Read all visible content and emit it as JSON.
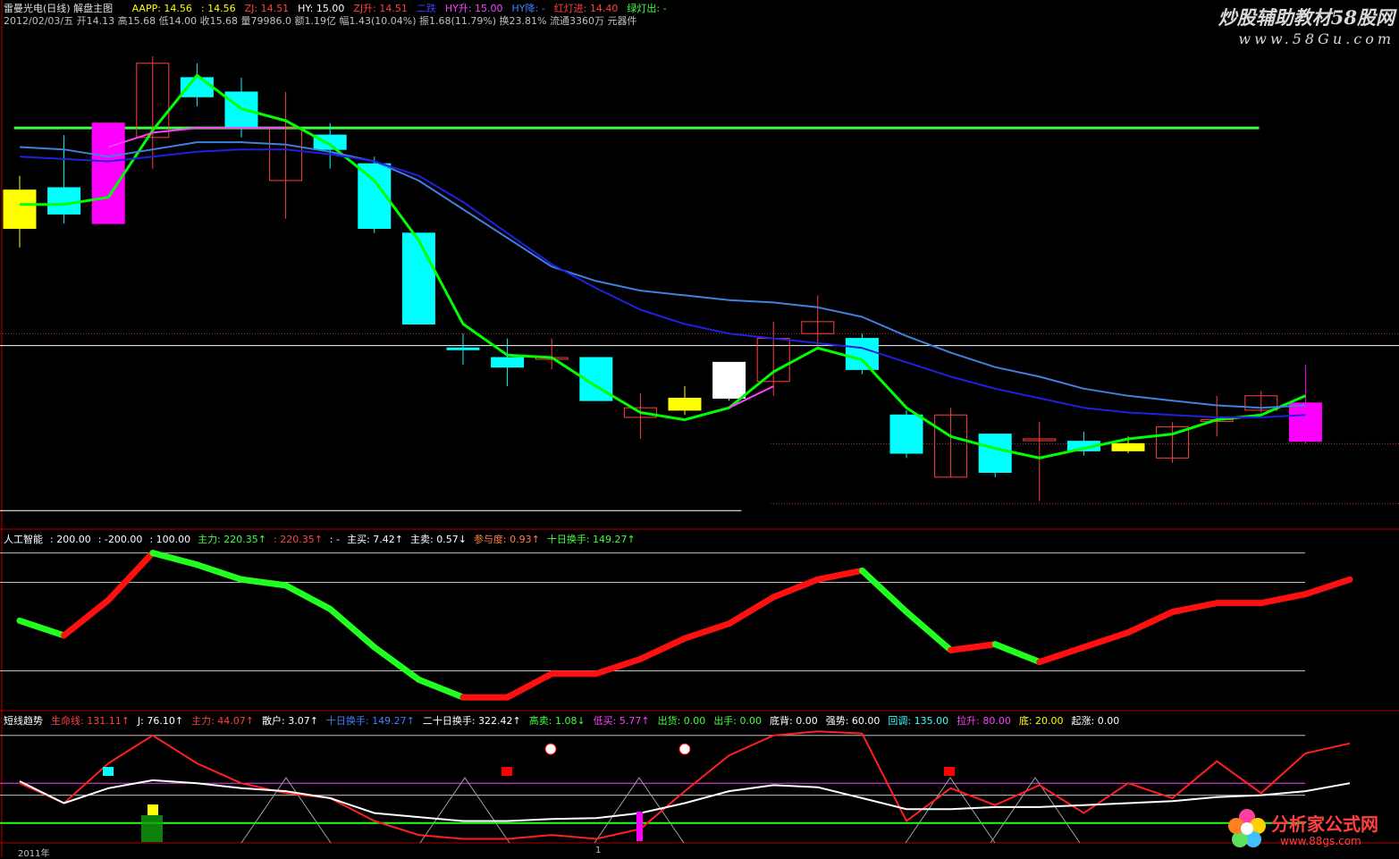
{
  "header": {
    "title": "雷曼光电(日线) 解盘主图",
    "info_line": "2012/02/03/五 开14.13 高15.68 低14.00 收15.68 量79986.0 额1.19亿 幅1.43(10.04%) 振1.68(11.79%) 换23.81% 流通3360万 元器件",
    "indicators": [
      {
        "text": "AAPP: 14.56",
        "color": "#ffff00"
      },
      {
        "text": ": 14.56",
        "color": "#ffff00"
      },
      {
        "text": "ZJ: 14.51",
        "color": "#ff4040"
      },
      {
        "text": "HY: 15.00",
        "color": "#ffffff"
      },
      {
        "text": "ZJ升: 14.51",
        "color": "#ff4040"
      },
      {
        "text": "二跌",
        "color": "#4040ff"
      },
      {
        "text": "HY升: 15.00",
        "color": "#ff40ff"
      },
      {
        "text": "HY降: -",
        "color": "#4080ff"
      },
      {
        "text": "红灯进: 14.40",
        "color": "#ff4040"
      },
      {
        "text": "绿灯出: -",
        "color": "#40ff40"
      }
    ]
  },
  "watermarks": {
    "top": "炒股辅助教材58股网",
    "top_url": "www.58Gu.com",
    "bottom": "分析家公式网",
    "bottom_url": "www.88gs.com"
  },
  "panel2_header": [
    {
      "text": "人工智能",
      "color": "#ffffff"
    },
    {
      "text": ": 200.00",
      "color": "#ffffff"
    },
    {
      "text": ": -200.00",
      "color": "#ffffff"
    },
    {
      "text": ": 100.00",
      "color": "#ffffff"
    },
    {
      "text": "主力: 220.35↑",
      "color": "#40ff40"
    },
    {
      "text": ": 220.35↑",
      "color": "#ff4040"
    },
    {
      "text": ": -",
      "color": "#ffffff"
    },
    {
      "text": "主买: 7.42↑",
      "color": "#ffffff"
    },
    {
      "text": "主卖: 0.57↓",
      "color": "#ffffff"
    },
    {
      "text": "参与度: 0.93↑",
      "color": "#ff8040"
    },
    {
      "text": "十日换手: 149.27↑",
      "color": "#40ff40"
    }
  ],
  "panel3_header": [
    {
      "text": "短线趋势",
      "color": "#ffffff"
    },
    {
      "text": "生命线: 131.11↑",
      "color": "#ff4040"
    },
    {
      "text": "J: 76.10↑",
      "color": "#ffffff"
    },
    {
      "text": "主力: 44.07↑",
      "color": "#ff4040"
    },
    {
      "text": "散户: 3.07↑",
      "color": "#ffffff"
    },
    {
      "text": "十日换手: 149.27↑",
      "color": "#4080ff"
    },
    {
      "text": "二十日换手: 322.42↑",
      "color": "#ffffff"
    },
    {
      "text": "高卖: 1.08↓",
      "color": "#40ff40"
    },
    {
      "text": "低买: 5.77↑",
      "color": "#ff40ff"
    },
    {
      "text": "出货: 0.00",
      "color": "#40ff40"
    },
    {
      "text": "出手: 0.00",
      "color": "#40ff40"
    },
    {
      "text": "底背: 0.00",
      "color": "#ffffff"
    },
    {
      "text": "强势: 60.00",
      "color": "#ffffff"
    },
    {
      "text": "回调: 135.00",
      "color": "#40ffff"
    },
    {
      "text": "拉升: 80.00",
      "color": "#ff40ff"
    },
    {
      "text": "底: 20.00",
      "color": "#ffff00"
    },
    {
      "text": "起涨: 0.00",
      "color": "#ffffff"
    }
  ],
  "x_axis": {
    "label_2011": "2011年",
    "label_1": "1"
  },
  "chart_data": [
    {
      "type": "candlestick",
      "candles": [
        {
          "o": 23.0,
          "c": 24.6,
          "h": 25.2,
          "l": 22.2,
          "color": "#ffff00",
          "fill": true
        },
        {
          "o": 24.7,
          "c": 23.6,
          "h": 26.9,
          "l": 23.2,
          "color": "#00ffff",
          "fill": true
        },
        {
          "o": 23.2,
          "c": 27.4,
          "h": 27.4,
          "l": 23.2,
          "color": "#ff00ff",
          "fill": true
        },
        {
          "o": 26.8,
          "c": 29.9,
          "h": 30.2,
          "l": 25.5,
          "color": "#ff4040",
          "fill": false
        },
        {
          "o": 29.3,
          "c": 28.5,
          "h": 29.9,
          "l": 28.1,
          "color": "#00ffff",
          "fill": true
        },
        {
          "o": 28.7,
          "c": 27.2,
          "h": 29.3,
          "l": 26.8,
          "color": "#00ffff",
          "fill": true
        },
        {
          "o": 25.0,
          "c": 27.2,
          "h": 28.7,
          "l": 23.4,
          "color": "#ff4040",
          "fill": false
        },
        {
          "o": 26.9,
          "c": 26.3,
          "h": 27.4,
          "l": 25.5,
          "color": "#00ffff",
          "fill": true
        },
        {
          "o": 25.7,
          "c": 23.0,
          "h": 26.0,
          "l": 22.8,
          "color": "#00ffff",
          "fill": true
        },
        {
          "o": 22.8,
          "c": 19.0,
          "h": 22.8,
          "l": 19.0,
          "color": "#00ffff",
          "fill": true
        },
        {
          "o": 18.0,
          "c": 18.0,
          "h": 18.6,
          "l": 17.3,
          "color": "#00ffff",
          "fill": true
        },
        {
          "o": 17.6,
          "c": 17.2,
          "h": 18.4,
          "l": 16.4,
          "color": "#00ffff",
          "fill": true
        },
        {
          "o": 17.6,
          "c": 17.6,
          "h": 18.4,
          "l": 17.1,
          "color": "#ff4040",
          "fill": false
        },
        {
          "o": 17.6,
          "c": 15.8,
          "h": 17.6,
          "l": 15.8,
          "color": "#00ffff",
          "fill": true
        },
        {
          "o": 15.1,
          "c": 15.5,
          "h": 16.1,
          "l": 14.2,
          "color": "#ff4040",
          "fill": false
        },
        {
          "o": 15.4,
          "c": 15.9,
          "h": 16.4,
          "l": 15.2,
          "color": "#ffff00",
          "fill": true
        },
        {
          "o": 15.9,
          "c": 17.4,
          "h": 17.4,
          "l": 15.8,
          "color": "#ffffff",
          "fill": true
        },
        {
          "o": 16.6,
          "c": 18.4,
          "h": 19.1,
          "l": 16.0,
          "color": "#ff4040",
          "fill": false
        },
        {
          "o": 18.6,
          "c": 19.1,
          "h": 20.2,
          "l": 18.1,
          "color": "#ff4040",
          "fill": false
        },
        {
          "o": 18.4,
          "c": 17.1,
          "h": 18.6,
          "l": 16.9,
          "color": "#00ffff",
          "fill": true
        },
        {
          "o": 15.2,
          "c": 13.6,
          "h": 15.4,
          "l": 13.4,
          "color": "#00ffff",
          "fill": true
        },
        {
          "o": 12.6,
          "c": 15.2,
          "h": 15.5,
          "l": 12.6,
          "color": "#ff4040",
          "fill": false
        },
        {
          "o": 14.4,
          "c": 12.8,
          "h": 14.4,
          "l": 12.6,
          "color": "#00ffff",
          "fill": true
        },
        {
          "o": 14.2,
          "c": 14.2,
          "h": 14.9,
          "l": 11.6,
          "color": "#ff4040",
          "fill": false
        },
        {
          "o": 14.1,
          "c": 13.7,
          "h": 14.5,
          "l": 13.5,
          "color": "#00ffff",
          "fill": true
        },
        {
          "o": 13.7,
          "c": 14.0,
          "h": 14.3,
          "l": 13.6,
          "color": "#ffff00",
          "fill": true
        },
        {
          "o": 13.4,
          "c": 14.7,
          "h": 14.9,
          "l": 13.2,
          "color": "#ff4040",
          "fill": false
        },
        {
          "o": 15.0,
          "c": 15.0,
          "h": 16.0,
          "l": 14.3,
          "color": "#ff4040",
          "fill": false
        },
        {
          "o": 15.4,
          "c": 16.0,
          "h": 16.2,
          "l": 15.3,
          "color": "#ff4040",
          "fill": false
        },
        {
          "o": 14.1,
          "c": 15.7,
          "h": 17.3,
          "l": 14.0,
          "color": "#ff00ff",
          "fill": true
        }
      ]
    },
    {
      "type": "line",
      "series": [
        {
          "color": "#00ff00",
          "width": 3,
          "values": [
            24.0,
            24.0,
            24.3,
            27.1,
            29.4,
            28.0,
            27.5,
            26.5,
            25.0,
            22.5,
            19.0,
            17.7,
            17.6,
            16.4,
            15.3,
            15.0,
            15.5,
            17.0,
            18.0,
            17.5,
            15.5,
            14.3,
            13.8,
            13.4,
            13.8,
            14.2,
            14.4,
            15.0,
            15.2,
            16.0
          ]
        },
        {
          "color": "#ff40ff",
          "width": 2,
          "values": [
            null,
            null,
            26.4,
            27.0,
            27.2,
            27.2,
            27.2,
            null,
            null,
            null,
            null,
            null,
            null,
            null,
            null,
            null,
            15.5,
            16.4,
            null,
            null,
            null,
            null,
            null,
            null,
            null,
            null,
            null,
            null,
            null,
            null
          ]
        },
        {
          "color": "#4080e0",
          "width": 2,
          "values": [
            26.4,
            26.3,
            26.0,
            26.3,
            26.6,
            26.6,
            26.5,
            26.2,
            25.8,
            25.0,
            23.8,
            22.6,
            21.4,
            20.8,
            20.4,
            20.2,
            20.0,
            19.9,
            19.7,
            19.3,
            18.5,
            17.8,
            17.2,
            16.8,
            16.3,
            16.0,
            15.8,
            15.6,
            15.5,
            15.6
          ]
        },
        {
          "color": "#2020e0",
          "width": 2,
          "values": [
            26.0,
            25.9,
            25.8,
            26.0,
            26.2,
            26.3,
            26.3,
            26.1,
            25.8,
            25.2,
            24.1,
            22.8,
            21.5,
            20.5,
            19.6,
            19.0,
            18.6,
            18.4,
            18.2,
            18.0,
            17.4,
            16.8,
            16.3,
            15.9,
            15.5,
            15.3,
            15.2,
            15.1,
            15.1,
            15.2
          ]
        }
      ],
      "hlines": [
        {
          "value": 27.2,
          "color": "#40ff40",
          "width": 3,
          "x0": 0.01,
          "x1": 0.9
        },
        {
          "value": 18.1,
          "color": "#ffffff",
          "width": 1,
          "x0": 0,
          "x1": 1
        },
        {
          "value": 11.2,
          "color": "#ffffff",
          "width": 1,
          "x0": 0,
          "x1": 0.53
        }
      ]
    },
    {
      "type": "line",
      "series": [
        {
          "name": "人工智能",
          "values": [
            -30,
            -80,
            40,
            200,
            160,
            110,
            90,
            10,
            -120,
            -230,
            -290,
            -290,
            -210,
            -210,
            -160,
            -90,
            -40,
            50,
            110,
            140,
            0,
            -130,
            -110,
            -170,
            -120,
            -70,
            0,
            30,
            30,
            60,
            110
          ]
        }
      ],
      "ylim": [
        -320,
        220
      ]
    },
    {
      "type": "line",
      "series": [
        {
          "name": "生命线",
          "color": "#ff2020",
          "values": [
            60,
            40,
            80,
            108,
            80,
            60,
            50,
            45,
            22,
            8,
            4,
            4,
            8,
            4,
            14,
            52,
            88,
            108,
            112,
            110,
            22,
            55,
            38,
            58,
            30,
            60,
            45,
            82,
            50,
            90,
            100
          ]
        },
        {
          "name": "J",
          "color": "#ffffff",
          "values": [
            62,
            40,
            55,
            63,
            60,
            55,
            52,
            45,
            30,
            26,
            22,
            22,
            24,
            25,
            30,
            40,
            52,
            58,
            56,
            45,
            34,
            34,
            36,
            36,
            38,
            40,
            42,
            46,
            48,
            52,
            60
          ]
        }
      ],
      "ylim": [
        0,
        115
      ]
    }
  ]
}
